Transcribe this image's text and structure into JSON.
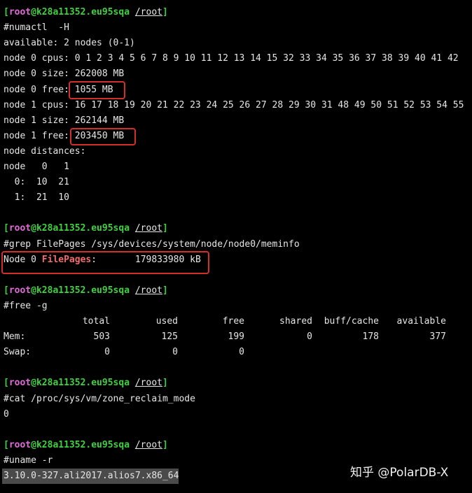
{
  "prompt": {
    "lb": "[",
    "user": "root",
    "at": "@",
    "host": "k28a11352.eu95sqa",
    "path": "/root",
    "rb": "]"
  },
  "lines": [
    {
      "kind": "prompt"
    },
    {
      "kind": "text",
      "text": "#numactl  -H"
    },
    {
      "kind": "text",
      "text": "available: 2 nodes (0-1)"
    },
    {
      "kind": "text",
      "text": "node 0 cpus: 0 1 2 3 4 5 6 7 8 9 10 11 12 13 14 15 32 33 34 35 36 37 38 39 40 41 42"
    },
    {
      "kind": "text",
      "text": "node 0 size: 262008 MB"
    },
    {
      "kind": "text",
      "text": "node 0 free: 1055 MB"
    },
    {
      "kind": "text",
      "text": "node 1 cpus: 16 17 18 19 20 21 22 23 24 25 26 27 28 29 30 31 48 49 50 51 52 53 54 55"
    },
    {
      "kind": "text",
      "text": "node 1 size: 262144 MB"
    },
    {
      "kind": "text",
      "text": "node 1 free: 203450 MB"
    },
    {
      "kind": "text",
      "text": "node distances:"
    },
    {
      "kind": "text",
      "text": "node   0   1"
    },
    {
      "kind": "text",
      "text": "  0:  10  21"
    },
    {
      "kind": "text",
      "text": "  1:  21  10"
    },
    {
      "kind": "blank"
    },
    {
      "kind": "prompt"
    },
    {
      "kind": "text",
      "text": "#grep FilePages /sys/devices/system/node/node0/meminfo"
    },
    {
      "kind": "filepages",
      "pre": "Node 0 ",
      "key": "FilePages",
      "rest": ":       179833980 kB"
    },
    {
      "kind": "blank"
    },
    {
      "kind": "prompt"
    },
    {
      "kind": "text",
      "text": "#free -g"
    },
    {
      "kind": "table",
      "cells": [
        "",
        "total",
        "used",
        "free",
        "shared",
        "buff/cache",
        "available"
      ]
    },
    {
      "kind": "table",
      "cells": [
        "Mem:",
        "503",
        "125",
        "199",
        "0",
        "178",
        "377"
      ]
    },
    {
      "kind": "table",
      "cells": [
        "Swap:",
        "0",
        "0",
        "0",
        "",
        "",
        ""
      ]
    },
    {
      "kind": "blank"
    },
    {
      "kind": "prompt"
    },
    {
      "kind": "text",
      "text": "#cat /proc/sys/vm/zone_reclaim_mode"
    },
    {
      "kind": "text",
      "text": "0"
    },
    {
      "kind": "blank"
    },
    {
      "kind": "prompt"
    },
    {
      "kind": "text",
      "text": "#uname -r"
    },
    {
      "kind": "selected",
      "text": "3.10.0-327.ali2017.alios7.x86_64"
    }
  ],
  "watermark": "知乎 @PolarDB-X",
  "colors": {
    "background": "#000000",
    "text": "#e6e6e6",
    "user": "#3fd13f",
    "host": "#e26ad8",
    "highlight_key": "#f26b6b",
    "box": "#d1302a"
  }
}
